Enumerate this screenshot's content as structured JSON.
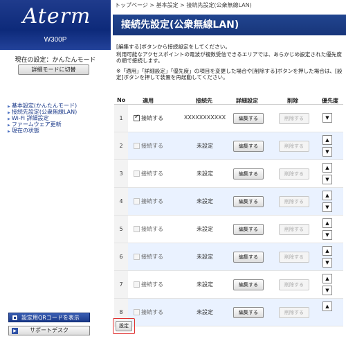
{
  "sidebar": {
    "logo": "Aterm",
    "model": "W300P",
    "mode_label": "現在の設定：かんたんモード",
    "mode_button": "詳細モードに切替",
    "nav": [
      {
        "label": "基本設定(かんたんモード)"
      },
      {
        "label": "接続先設定(公衆無線LAN)"
      },
      {
        "label": "Wi-Fi 詳細設定"
      },
      {
        "label": "ファームウェア更新"
      },
      {
        "label": "現在の状態"
      }
    ],
    "qr_button": "設定用QRコードを表示",
    "support_button": "サポートデスク"
  },
  "header": {
    "breadcrumb": "トップページ > 基本設定 > 接続先設定(公衆無線LAN)",
    "title": "接続先設定(公衆無線LAN)"
  },
  "description": {
    "line1": "[編集する]ボタンから接続設定をしてください。",
    "line2": "利用可能なアクセスポイントの電波が複数受信できるエリアでは、あらかじめ設定された優先度の順で接続します。",
    "line3": "※「適用」「詳細設定」「優先度」の項目を変更した場合や[削除する]ボタンを押した場合は、[設定]ボタンを押して装置を再起動してください。"
  },
  "table": {
    "headers": {
      "no": "No",
      "apply": "適用",
      "dest": "接続先",
      "detail": "詳細設定",
      "delete": "削除",
      "priority": "優先度"
    },
    "rows": [
      {
        "no": "1",
        "apply_label": "接続する",
        "checked": true,
        "dest": "XXXXXXXXXXX",
        "edit": "編集する",
        "delete": "削除する"
      },
      {
        "no": "2",
        "apply_label": "接続する",
        "checked": false,
        "dest": "未設定",
        "edit": "編集する",
        "delete": "削除する"
      },
      {
        "no": "3",
        "apply_label": "接続する",
        "checked": false,
        "dest": "未設定",
        "edit": "編集する",
        "delete": "削除する"
      },
      {
        "no": "4",
        "apply_label": "接続する",
        "checked": false,
        "dest": "未設定",
        "edit": "編集する",
        "delete": "削除する"
      },
      {
        "no": "5",
        "apply_label": "接続する",
        "checked": false,
        "dest": "未設定",
        "edit": "編集する",
        "delete": "削除する"
      },
      {
        "no": "6",
        "apply_label": "接続する",
        "checked": false,
        "dest": "未設定",
        "edit": "編集する",
        "delete": "削除する"
      },
      {
        "no": "7",
        "apply_label": "接続する",
        "checked": false,
        "dest": "未設定",
        "edit": "編集する",
        "delete": "削除する"
      },
      {
        "no": "8",
        "apply_label": "接続する",
        "checked": false,
        "dest": "未設定",
        "edit": "編集する",
        "delete": "削除する"
      }
    ]
  },
  "footer": {
    "set_button": "設定"
  }
}
